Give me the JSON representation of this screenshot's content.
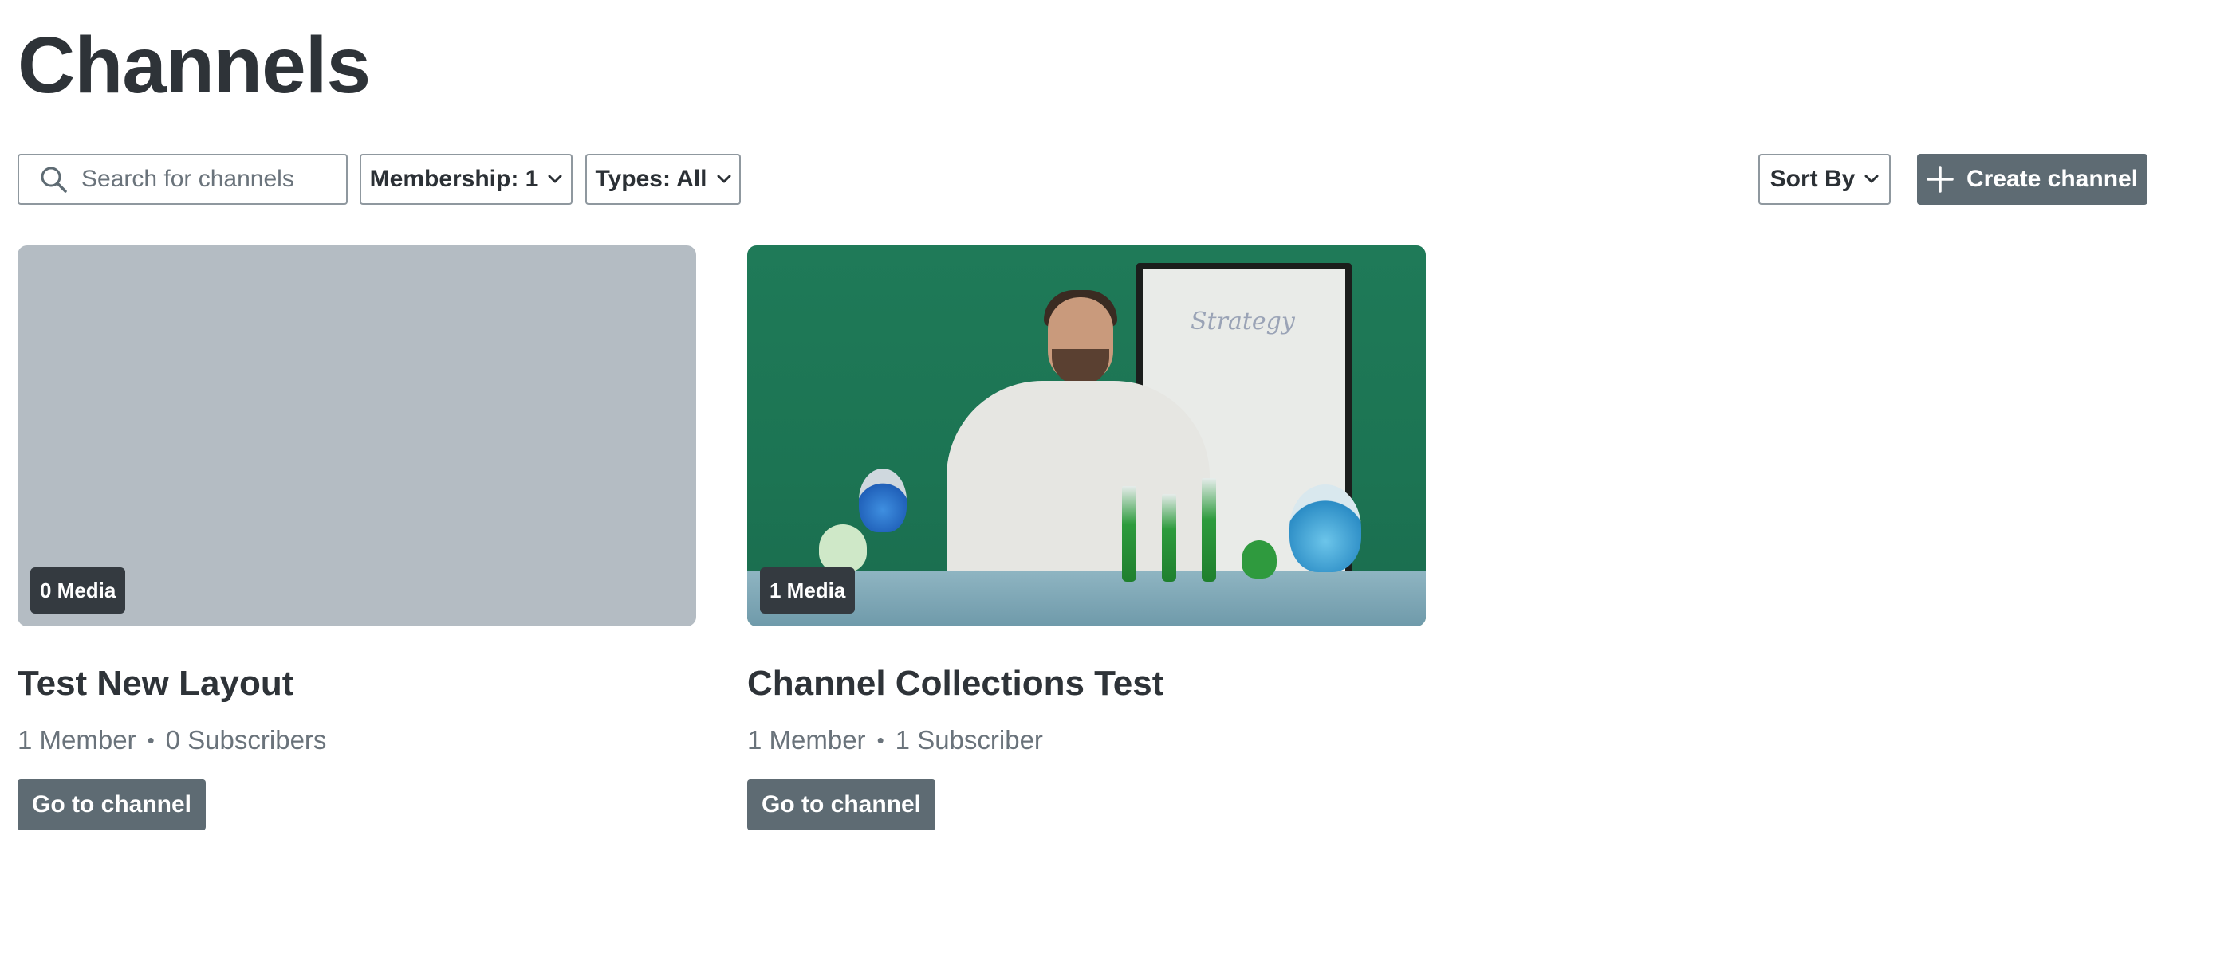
{
  "page": {
    "title": "Channels"
  },
  "toolbar": {
    "search_placeholder": "Search for channels",
    "membership_label": "Membership: 1",
    "types_label": "Types: All",
    "sort_label": "Sort By",
    "create_label": "Create channel"
  },
  "icons": {
    "search": "search-icon",
    "chevron": "chevron-down-icon",
    "plus": "plus-icon"
  },
  "channels": [
    {
      "title": "Test New Layout",
      "media_badge": "0 Media",
      "members": "1 Member",
      "subscribers": "0 Subscribers",
      "button_label": "Go to channel",
      "has_thumbnail": false
    },
    {
      "title": "Channel Collections Test",
      "media_badge": "1 Media",
      "members": "1 Member",
      "subscribers": "1 Subscriber",
      "button_label": "Go to channel",
      "has_thumbnail": true
    }
  ],
  "colors": {
    "primary_button": "#5e6b73",
    "placeholder_thumb": "#b4bcc3",
    "badge_bg": "#343a40"
  }
}
